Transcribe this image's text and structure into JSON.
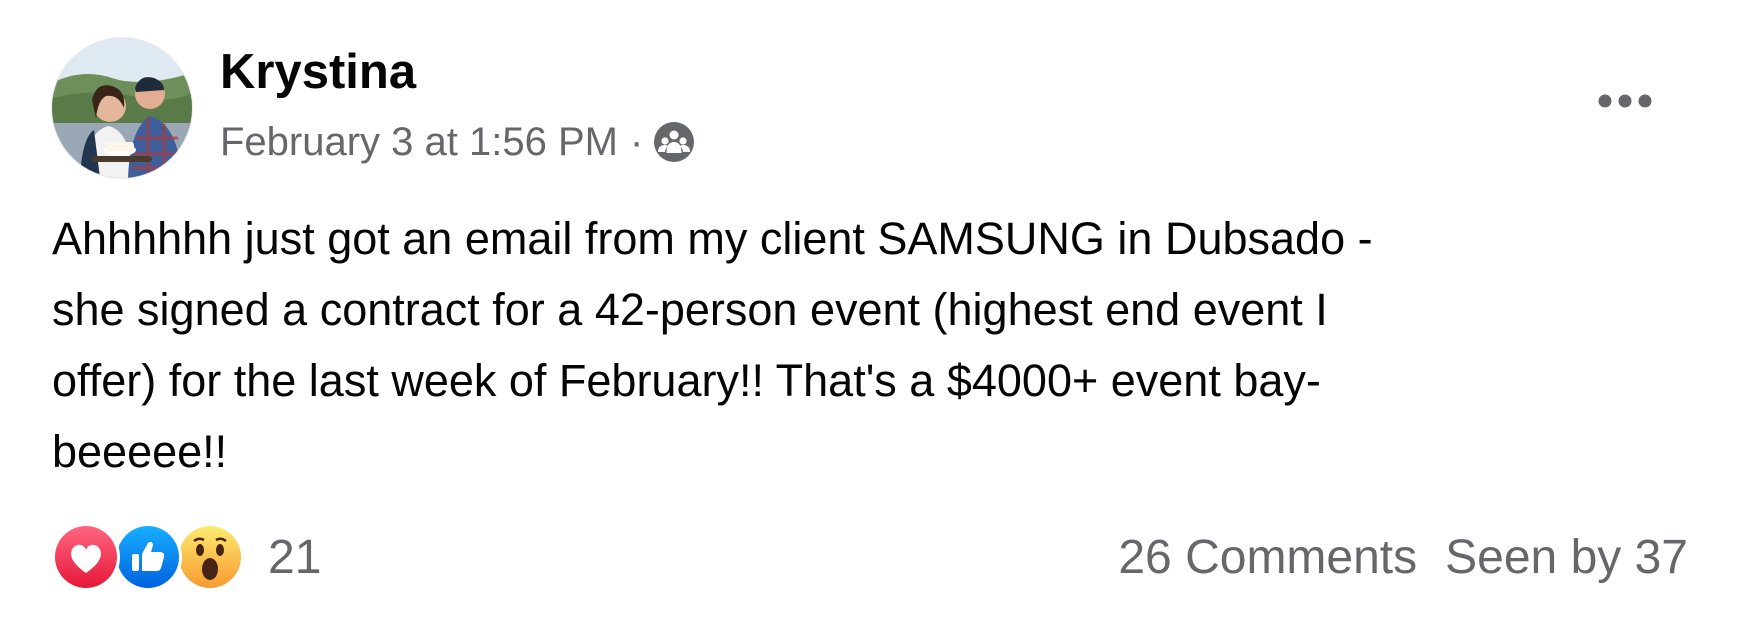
{
  "post": {
    "author": {
      "name": "Krystina",
      "avatar_icon": "profile-photo"
    },
    "timestamp": "February 3 at 1:56 PM",
    "separator": "·",
    "audience_icon": "group-members-icon",
    "more_icon": "more-options-icon",
    "text": "Ahhhhhh just got an email from my client SAMSUNG in Dubsado -\nshe signed a contract for a 42-person event (highest end event I\noffer) for the last week of February!! That's a $4000+ event bay-\nbeeeee!!",
    "reactions": {
      "icons": [
        "love-reaction-icon",
        "like-reaction-icon",
        "wow-reaction-icon"
      ],
      "count": "21"
    },
    "comments_label": "26 Comments",
    "seen_label": "Seen by 37"
  },
  "colors": {
    "text_primary": "#050505",
    "text_secondary": "#65676b",
    "love": "#f33e58",
    "like": "#1877f2",
    "wow": "#f7b125"
  }
}
